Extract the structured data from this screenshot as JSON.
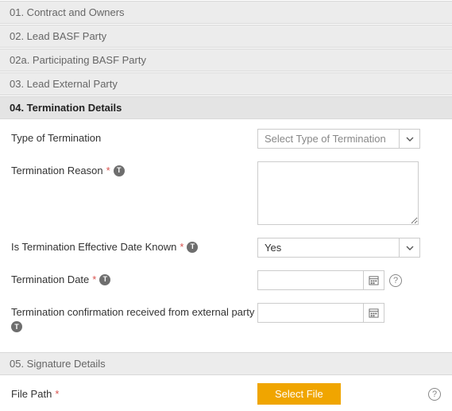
{
  "sections": {
    "s01": "01. Contract and Owners",
    "s02": "02. Lead BASF Party",
    "s02a": "02a. Participating BASF Party",
    "s03": "03. Lead External Party",
    "s04": "04. Termination Details",
    "s05": "05. Signature Details"
  },
  "termination": {
    "typeLabel": "Type of Termination",
    "typePlaceholder": "Select Type of Termination",
    "reasonLabel": "Termination Reason",
    "reasonValue": "",
    "knownLabel": "Is Termination Effective Date Known",
    "knownValue": "Yes",
    "dateLabel": "Termination Date",
    "dateValue": "",
    "confirmLabel": "Termination confirmation received from external party",
    "confirmValue": ""
  },
  "file": {
    "label": "File Path",
    "button": "Select File"
  },
  "glyphs": {
    "req": "*",
    "info": "T",
    "help": "?"
  }
}
